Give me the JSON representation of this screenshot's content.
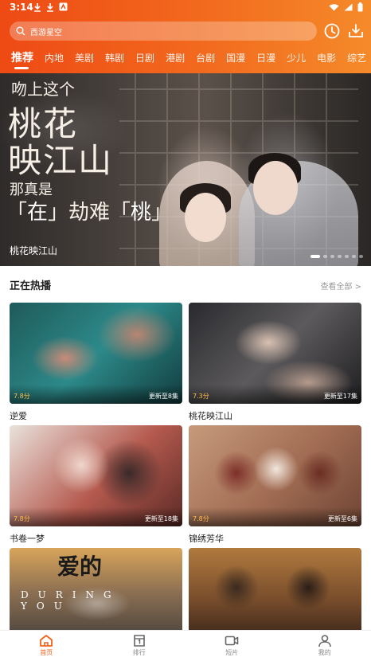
{
  "status_bar": {
    "time": "3:14"
  },
  "search": {
    "placeholder": "西游星空"
  },
  "tabs": [
    "推荐",
    "内地",
    "美剧",
    "韩剧",
    "日剧",
    "港剧",
    "台剧",
    "国漫",
    "日漫",
    "少儿",
    "电影",
    "综艺"
  ],
  "active_tab": "推荐",
  "banner": {
    "promo_line1": "吻上这个",
    "promo_line2": "桃花",
    "promo_line3": "映江山",
    "promo_line4": "那真是",
    "promo_line5_a": "「",
    "promo_line5_b": "在",
    "promo_line5_c": "」劫难「",
    "promo_line5_d": "桃",
    "promo_line5_e": "」",
    "caption": "桃花映江山",
    "slide_count": 7,
    "active_slide": 0
  },
  "section": {
    "title": "正在热播",
    "see_all": "查看全部 >"
  },
  "shows": [
    {
      "title": "逆爱",
      "score": "7.8分",
      "episodes": "更新至8集"
    },
    {
      "title": "桃花映江山",
      "score": "7.3分",
      "episodes": "更新至17集"
    },
    {
      "title": "书卷一梦",
      "score": "7.8分",
      "episodes": "更新至18集"
    },
    {
      "title": "锦绣芳华",
      "score": "7.8分",
      "episodes": "更新至6集"
    },
    {
      "title": "",
      "score": "",
      "episodes": "",
      "poster_text": "爱的",
      "poster_sub": "DURING YOU"
    },
    {
      "title": "",
      "score": "",
      "episodes": ""
    }
  ],
  "bottom_nav": [
    {
      "label": "首页",
      "icon": "home-icon",
      "active": true
    },
    {
      "label": "排行",
      "icon": "ranking-icon",
      "active": false
    },
    {
      "label": "短片",
      "icon": "video-icon",
      "active": false
    },
    {
      "label": "我的",
      "icon": "person-icon",
      "active": false
    }
  ],
  "colors": {
    "accent": "#f2611c",
    "header_start": "#ee4a14",
    "header_end": "#f58a2a"
  }
}
